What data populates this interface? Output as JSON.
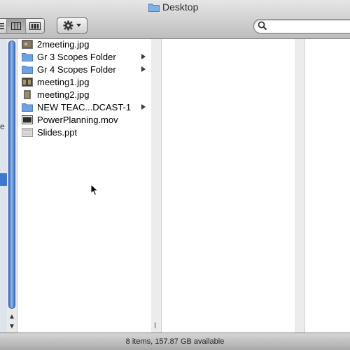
{
  "window": {
    "title": "Desktop",
    "icon": "folder-icon"
  },
  "toolbar": {
    "view_buttons": [
      "icon-view",
      "column-view",
      "coverflow-view"
    ],
    "active_view": "column-view",
    "action_icon": "gear-icon",
    "search_placeholder": "",
    "search_value": ""
  },
  "sidebar": {
    "fragment": "e"
  },
  "files": [
    {
      "name": "2meeting.jpg",
      "icon": "image-icon",
      "folder": false
    },
    {
      "name": "Gr 3 Scopes Folder",
      "icon": "folder-icon",
      "folder": true
    },
    {
      "name": "Gr 4 Scopes Folder",
      "icon": "folder-icon",
      "folder": true
    },
    {
      "name": "meeting1.jpg",
      "icon": "image-icon",
      "folder": false
    },
    {
      "name": "meeting2.jpg",
      "icon": "image-icon",
      "folder": false
    },
    {
      "name": "NEW TEAC...DCAST-1",
      "icon": "folder-icon",
      "folder": true
    },
    {
      "name": "PowerPlanning.mov",
      "icon": "movie-icon",
      "folder": false
    },
    {
      "name": "Slides.ppt",
      "icon": "document-icon",
      "folder": false
    }
  ],
  "status": {
    "text": "8 items, 157.87 GB available"
  },
  "colors": {
    "folder_blue": "#6fa3e0",
    "selection_blue": "#3d7acf",
    "scroll_thumb": "#3c71c8"
  }
}
